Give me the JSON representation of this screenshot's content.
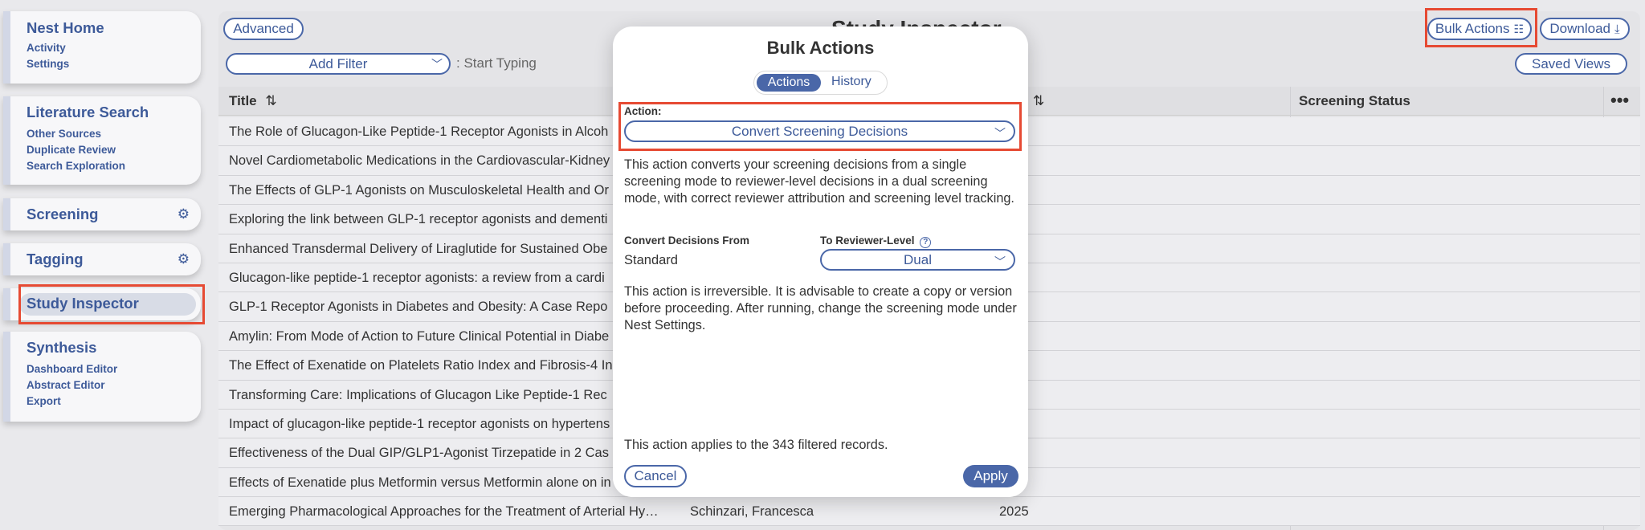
{
  "sidebar": {
    "nest_home": "Nest Home",
    "activity": "Activity",
    "settings": "Settings",
    "literature_search": "Literature Search",
    "other_sources": "Other Sources",
    "duplicate_review": "Duplicate Review",
    "search_exploration": "Search Exploration",
    "screening": "Screening",
    "tagging": "Tagging",
    "study_inspector": "Study Inspector",
    "synthesis": "Synthesis",
    "dashboard_editor": "Dashboard Editor",
    "abstract_editor": "Abstract Editor",
    "export": "Export"
  },
  "toolbar": {
    "advanced": "Advanced",
    "page_title": "Study Inspector",
    "bulk_actions": "Bulk Actions",
    "download": "Download",
    "add_filter": "Add Filter",
    "filter_prompt": ": Start Typing",
    "saved_views": "Saved Views"
  },
  "table": {
    "headers": {
      "title": "Title",
      "screening_status": "Screening Status"
    },
    "rows": [
      {
        "title": "The Role of Glucagon-Like Peptide-1 Receptor Agonists in Alcoh",
        "author": "",
        "year": ""
      },
      {
        "title": "Novel Cardiometabolic Medications in the Cardiovascular-Kidney",
        "author": "",
        "year": ""
      },
      {
        "title": "The Effects of GLP-1 Agonists on Musculoskeletal Health and Or",
        "author": "",
        "year": ""
      },
      {
        "title": "Exploring the link between GLP-1 receptor agonists and dementi",
        "author": "",
        "year": ""
      },
      {
        "title": "Enhanced Transdermal Delivery of Liraglutide for Sustained Obe",
        "author": "",
        "year": ""
      },
      {
        "title": "Glucagon-like peptide-1 receptor agonists: a review from a cardi",
        "author": "",
        "year": ""
      },
      {
        "title": "GLP-1 Receptor Agonists in Diabetes and Obesity: A Case Repo",
        "author": "",
        "year": ""
      },
      {
        "title": "Amylin: From Mode of Action to Future Clinical Potential in Diabe",
        "author": "",
        "year": ""
      },
      {
        "title": "The Effect of Exenatide on Platelets Ratio Index and Fibrosis-4 In",
        "author": "",
        "year": ""
      },
      {
        "title": "Transforming Care: Implications of Glucagon Like Peptide-1 Rec",
        "author": "",
        "year": ""
      },
      {
        "title": "Impact of glucagon-like peptide-1 receptor agonists on hypertens",
        "author": "",
        "year": ""
      },
      {
        "title": "Effectiveness of the Dual GIP/GLP1-Agonist Tirzepatide in 2 Cas",
        "author": "",
        "year": ""
      },
      {
        "title": "Effects of Exenatide plus Metformin versus Metformin alone on in",
        "author": "",
        "year": ""
      },
      {
        "title": "Emerging Pharmacological Approaches for the Treatment of Arterial Hy…",
        "author": "Schinzari, Francesca",
        "year": "2025"
      }
    ]
  },
  "modal": {
    "title": "Bulk Actions",
    "tab_actions": "Actions",
    "tab_history": "History",
    "action_label": "Action:",
    "action_value": "Convert Screening Decisions",
    "description": "This action converts your screening decisions from a single screening mode to reviewer-level decisions in a dual screening mode, with correct reviewer attribution and screening level tracking.",
    "from_label": "Convert Decisions From",
    "from_value": "Standard",
    "to_label": "To Reviewer-Level",
    "to_value": "Dual",
    "warning": "This action is irreversible. It is advisable to create a copy or version before proceeding. After running, change the screening mode under Nest Settings.",
    "applies": "This action applies to the 343 filtered records.",
    "cancel": "Cancel",
    "apply": "Apply"
  }
}
